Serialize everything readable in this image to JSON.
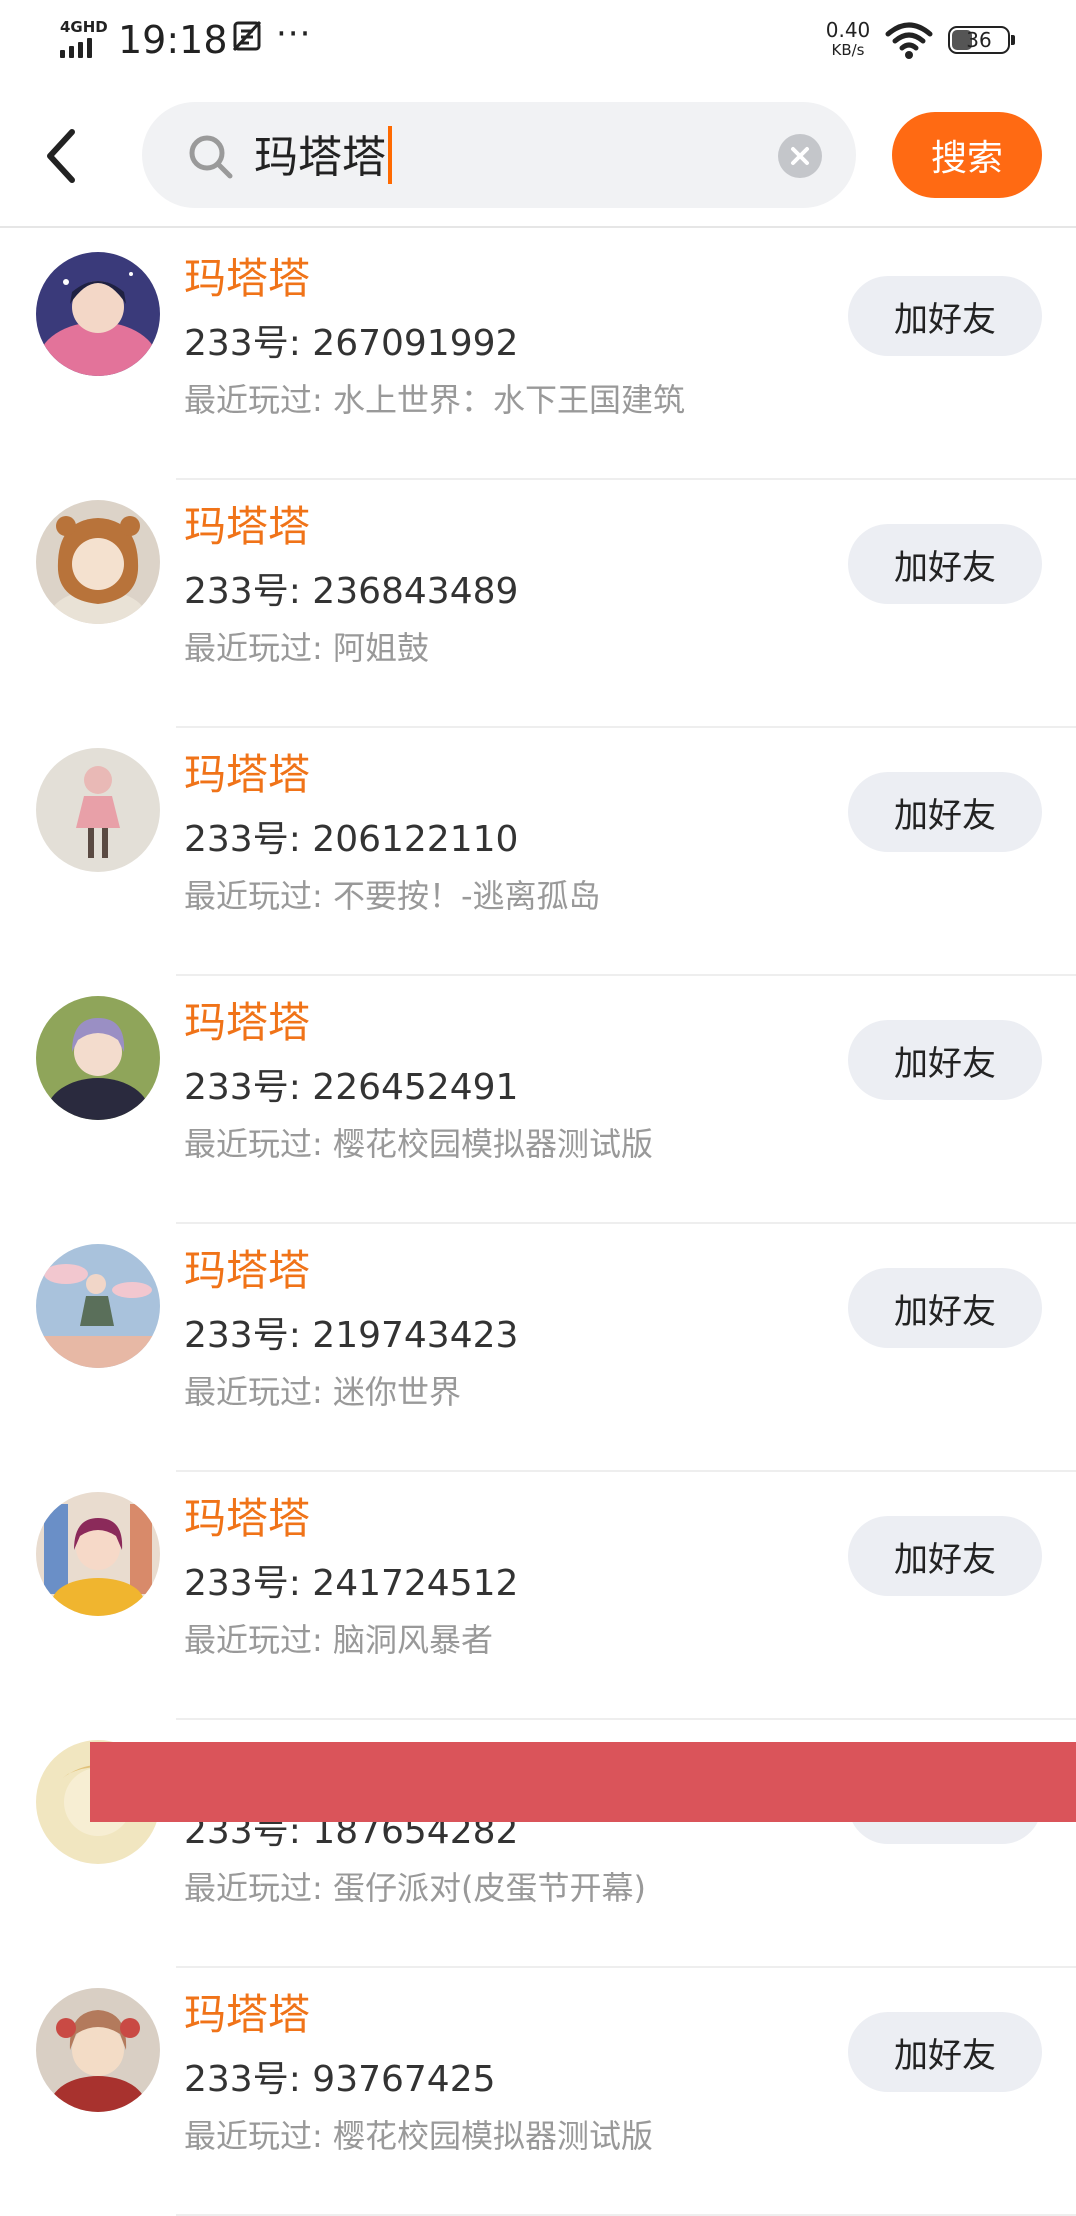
{
  "status_bar": {
    "network": "4GHD",
    "time": "19:18",
    "extra_icon": "alarm-off-icon",
    "more": "···",
    "net_speed_value": "0.40",
    "net_speed_unit": "KB/s",
    "battery": "36"
  },
  "search": {
    "query": "玛塔塔",
    "button_label": "搜索"
  },
  "colors": {
    "accent": "#f07318",
    "search_button": "#ff6a13",
    "redaction": "#da545a"
  },
  "results": [
    {
      "name": "玛塔塔",
      "id": "233号: 267091992",
      "played": "最近玩过: 水上世界：水下王国建筑",
      "button": "加好友"
    },
    {
      "name": "玛塔塔",
      "id": "233号: 236843489",
      "played": "最近玩过: 阿姐鼓",
      "button": "加好友"
    },
    {
      "name": "玛塔塔",
      "id": "233号: 206122110",
      "played": "最近玩过: 不要按！-逃离孤岛",
      "button": "加好友"
    },
    {
      "name": "玛塔塔",
      "id": "233号: 226452491",
      "played": "最近玩过: 樱花校园模拟器测试版",
      "button": "加好友"
    },
    {
      "name": "玛塔塔",
      "id": "233号: 219743423",
      "played": "最近玩过: 迷你世界",
      "button": "加好友"
    },
    {
      "name": "玛塔塔",
      "id": "233号: 241724512",
      "played": "最近玩过: 脑洞风暴者",
      "button": "加好友"
    },
    {
      "name": "",
      "id": "233号: 187654282",
      "played": "最近玩过: 蛋仔派对(皮蛋节开幕)",
      "button": ""
    },
    {
      "name": "玛塔塔",
      "id": "233号: 93767425",
      "played": "最近玩过: 樱花校园模拟器测试版",
      "button": "加好友"
    }
  ]
}
